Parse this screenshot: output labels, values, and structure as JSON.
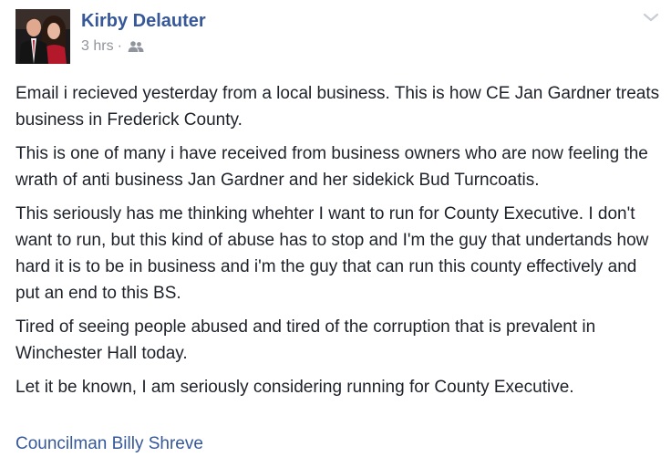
{
  "post": {
    "author": "Kirby Delauter",
    "timestamp": "3 hrs",
    "separator": "·",
    "audience_icon": "friends-icon",
    "options_icon": "chevron-down-icon",
    "paragraphs": [
      "Email i recieved yesterday from a local business. This is how CE Jan Gardner treats business in Frederick County.",
      "This is one of many i have received from business owners who are now feeling the wrath of anti business Jan Gardner and her sidekick Bud Turncoatis.",
      "This seriously has me thinking whehter I want to run for County Executive. I don't want to run, but this kind of abuse has to stop and I'm the guy that undertands how hard it is to be in business and i'm the guy that can run this county effectively and put an end to this BS.",
      "Tired of seeing people abused and tired of the corruption that is prevalent in Winchester Hall today.",
      "Let it be known, I am seriously considering running for County Executive."
    ],
    "mention": "Councilman Billy Shreve"
  },
  "colors": {
    "link": "#365899",
    "meta": "#90949c",
    "text": "#1d2129"
  }
}
